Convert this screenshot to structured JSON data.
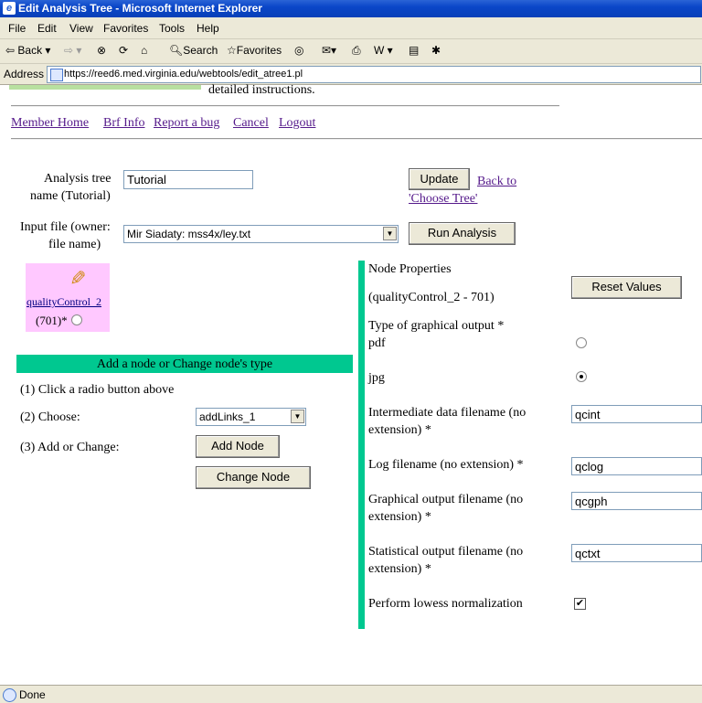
{
  "window": {
    "title": "Edit Analysis Tree - Microsoft Internet Explorer"
  },
  "menu": [
    "File",
    "Edit",
    "View",
    "Favorites",
    "Tools",
    "Help"
  ],
  "toolbar": {
    "back": "Back",
    "search": "Search",
    "favorites": "Favorites"
  },
  "address": {
    "label": "Address",
    "url": "https://reed6.med.virginia.edu/webtools/edit_atree1.pl"
  },
  "page": {
    "top_fragment": "detailed instructions.",
    "nav": [
      "Member Home",
      "Brf Info",
      "Report a bug",
      "Cancel",
      "Logout"
    ],
    "tree_name_label_1": "Analysis tree",
    "tree_name_label_2": "name (Tutorial)",
    "tree_name_value": "Tutorial",
    "update_button": "Update",
    "back_link_1": "Back to",
    "back_link_2": "'Choose Tree'",
    "input_label_1": "Input file (owner:",
    "input_label_2": "file name)",
    "input_selected": "Mir Siadaty: mss4x/ley.txt",
    "run_button": "Run Analysis",
    "node": {
      "link": "qualityControl_2",
      "id": "(701)*"
    },
    "add_node_header": "Add a node or Change node's type",
    "step1": "(1) Click a radio button above",
    "step2": "(2) Choose:",
    "step2_selected": "addLinks_1",
    "step3": "(3) Add or Change:",
    "add_node_button": "Add Node",
    "change_node_button": "Change Node",
    "props": {
      "title": "Node Properties",
      "subtitle": "(qualityControl_2 - 701)",
      "reset_button": "Reset Values",
      "output_type_label": "Type of graphical output *",
      "pdf": "pdf",
      "jpg": "jpg",
      "intermediate_label_1": "Intermediate data filename (no",
      "intermediate_label_2": "extension) *",
      "intermediate_value": "qcint",
      "log_label": "Log filename (no extension) *",
      "log_value": "qclog",
      "graph_label_1": "Graphical output filename (no",
      "graph_label_2": "extension) *",
      "graph_value": "qcgph",
      "stat_label_1": "Statistical output filename (no",
      "stat_label_2": "extension) *",
      "stat_value": "qctxt",
      "lowess_label": "Perform lowess normalization"
    }
  },
  "status": {
    "text": "Done"
  },
  "colors": {
    "accent_green": "#00c890",
    "node_bg": "#ffc8ff",
    "link": "#551a8b"
  }
}
